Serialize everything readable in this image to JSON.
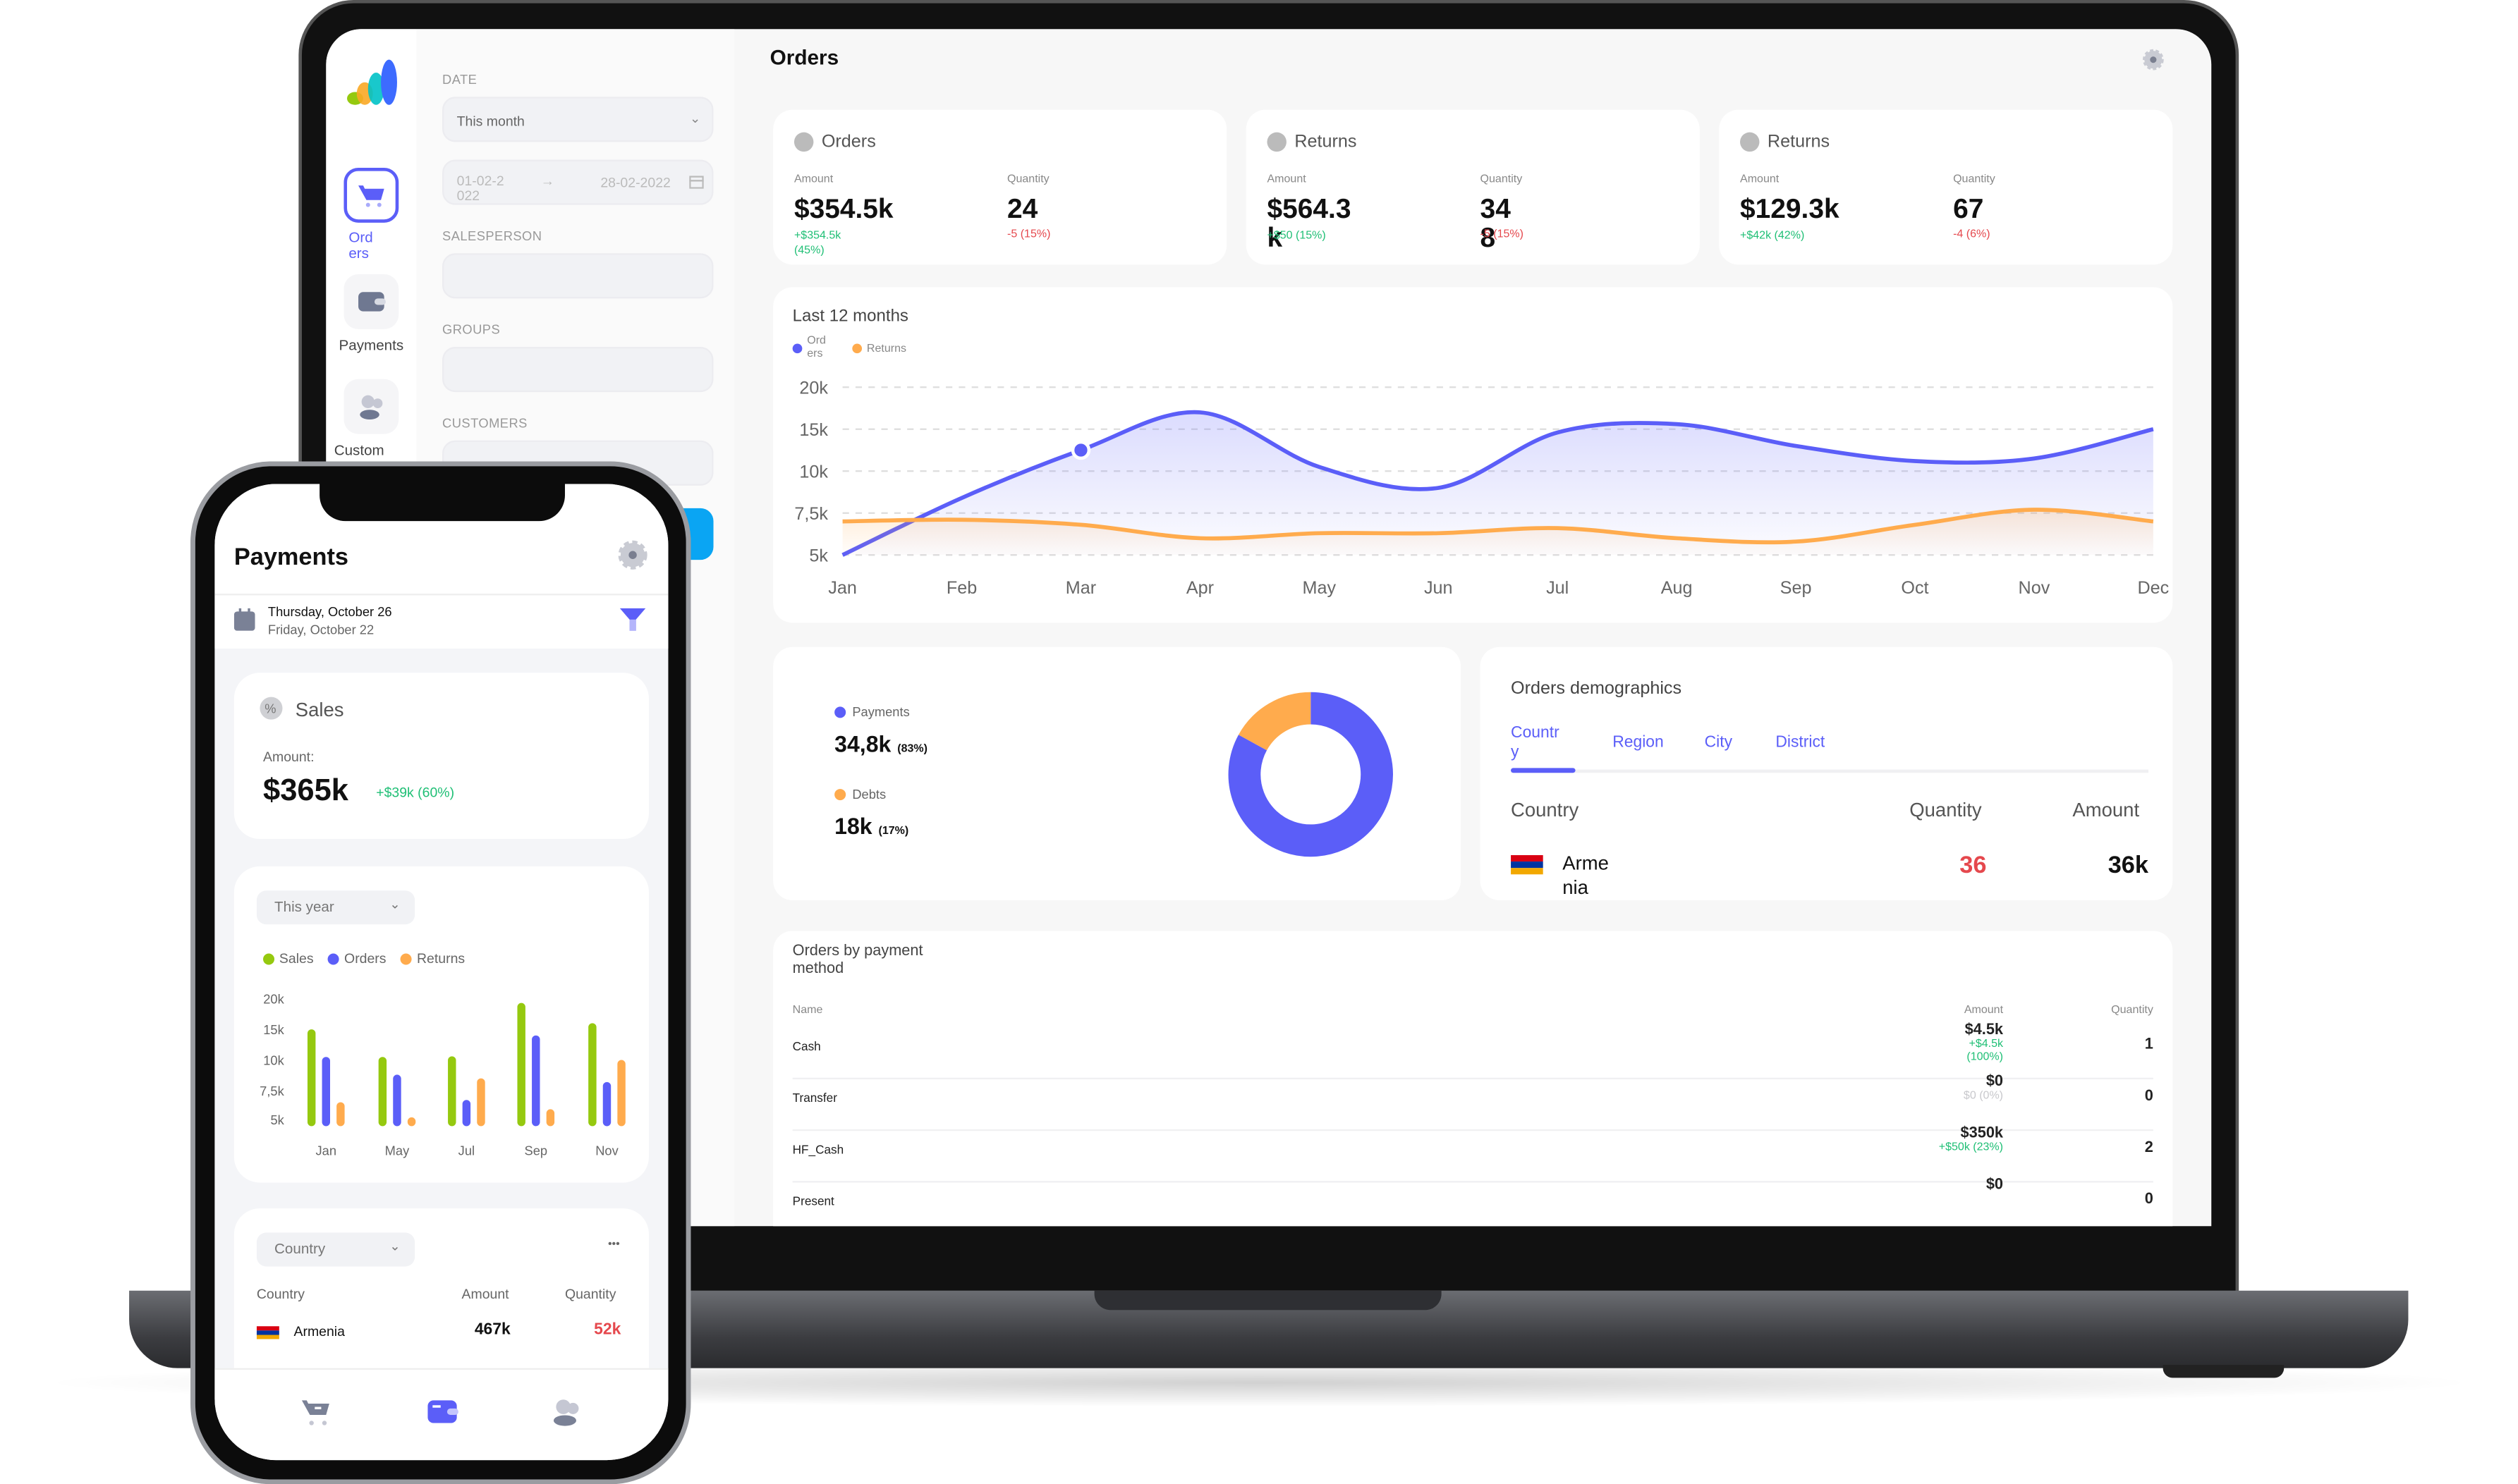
{
  "colors": {
    "accent": "#5b5ef8",
    "orders": "#5b5ef8",
    "returns": "#ffab4d",
    "sales": "#95c90f",
    "positive": "#1fbf75",
    "negative": "#e5484d"
  },
  "laptop": {
    "nav": {
      "items": [
        {
          "label": "Orders",
          "icon": "cart-icon",
          "active": true
        },
        {
          "label": "Payments",
          "icon": "wallet-icon"
        },
        {
          "label": "Custom",
          "icon": "users-icon"
        }
      ]
    },
    "filters": {
      "date_label": "DATE",
      "date_value": "This month",
      "date_from": "01-02-2022",
      "date_to": "28-02-2022",
      "date_arrow": "→",
      "salesperson_label": "SALESPERSON",
      "groups_label": "GROUPS",
      "customers_label": "CUSTOMERS"
    },
    "main": {
      "title": "Orders",
      "cards": [
        {
          "title": "Orders",
          "icon": "cart-icon",
          "amount_label": "Amount",
          "amount": "$354.5k",
          "amount_delta": "+$354.5k (45%)",
          "qty_label": "Quantity",
          "qty": "24",
          "qty_delta": "-5 (15%)"
        },
        {
          "title": "Returns",
          "icon": "return-icon",
          "amount_label": "Amount",
          "amount": "$564.3k",
          "amount_delta": "+$50 (15%)",
          "qty_label": "Quantity",
          "qty": "348",
          "qty_delta": "-5 (15%)"
        },
        {
          "title": "Returns",
          "icon": "compass-icon",
          "amount_label": "Amount",
          "amount": "$129.3k",
          "amount_delta": "+$42k (42%)",
          "qty_label": "Quantity",
          "qty": "67",
          "qty_delta": "-4 (6%)"
        }
      ],
      "payments": {
        "items": [
          {
            "label": "Payments",
            "value": "34,8k",
            "pct": "(83%)",
            "color": "#5b5ef8"
          },
          {
            "label": "Debts",
            "value": "18k",
            "pct": "(17%)",
            "color": "#ffab4d"
          }
        ]
      },
      "demographics": {
        "title": "Orders demographics",
        "tabs": [
          "Country",
          "Region",
          "City",
          "District"
        ],
        "active_tab": 0,
        "headers": [
          "Country",
          "Quantity",
          "Amount"
        ],
        "rows": [
          {
            "country": "Armenia",
            "quantity": "36",
            "amount": "36k"
          }
        ]
      },
      "payment_methods": {
        "title": "Orders by payment method",
        "headers": [
          "Name",
          "Amount",
          "Quantity"
        ],
        "rows": [
          {
            "name": "Cash",
            "amount": "$4.5k",
            "delta": "+$4.5k (100%)",
            "delta_type": "positive",
            "qty": "1"
          },
          {
            "name": "Transfer",
            "amount": "$0",
            "delta": "$0 (0%)",
            "delta_type": "neutral",
            "qty": "0"
          },
          {
            "name": "HF_Cash",
            "amount": "$350k",
            "delta": "+$50k (23%)",
            "delta_type": "positive",
            "qty": "2"
          },
          {
            "name": "Present",
            "amount": "$0",
            "delta": "",
            "delta_type": "neutral",
            "qty": "0"
          }
        ]
      }
    }
  },
  "phone": {
    "title": "Payments",
    "date_primary": "Thursday, October 26",
    "date_secondary": "Friday, October 22",
    "sales": {
      "title": "Sales",
      "amount_label": "Amount:",
      "amount": "$365k",
      "delta": "+$39k (60%)"
    },
    "period": "This year",
    "country_select": "Country",
    "more": "•••",
    "table": {
      "headers": [
        "Country",
        "Amount",
        "Quantity"
      ],
      "rows": [
        {
          "country": "Armenia",
          "amount": "467k",
          "quantity": "52k"
        }
      ]
    },
    "tabs": [
      {
        "icon": "cart-icon"
      },
      {
        "icon": "wallet-icon",
        "active": true
      },
      {
        "icon": "users-icon"
      }
    ]
  },
  "chart_data": [
    {
      "type": "line",
      "title": "Last 12 months",
      "categories": [
        "Jan",
        "Feb",
        "Mar",
        "Apr",
        "May",
        "Jun",
        "Jul",
        "Aug",
        "Sep",
        "Oct",
        "Nov",
        "Dec"
      ],
      "y_ticks": [
        "20k",
        "15k",
        "10k",
        "7,5k",
        "5k"
      ],
      "y_tick_values": [
        20000,
        15000,
        10000,
        7500,
        5000
      ],
      "grid": true,
      "legend": "top-left",
      "series": [
        {
          "name": "Orders",
          "color": "#5b5ef8",
          "values": [
            5000,
            8400,
            12500,
            17000,
            10500,
            9000,
            14600,
            15600,
            13000,
            11200,
            11500,
            15000
          ]
        },
        {
          "name": "Returns",
          "color": "#ffab4d",
          "values": [
            7000,
            7100,
            6800,
            6000,
            6300,
            6300,
            6600,
            6000,
            5800,
            6800,
            7700,
            7000
          ]
        }
      ],
      "highlight": {
        "category": "Mar",
        "series": "Orders"
      }
    },
    {
      "type": "pie",
      "series": [
        {
          "name": "Payments",
          "value": 83,
          "color": "#5b5ef8"
        },
        {
          "name": "Debts",
          "value": 17,
          "color": "#ffab4d"
        }
      ],
      "donut": true
    },
    {
      "type": "bar",
      "categories": [
        "Jan",
        "May",
        "Jul",
        "Sep",
        "Nov"
      ],
      "y_ticks": [
        "20k",
        "15k",
        "10k",
        "7,5k",
        "5k"
      ],
      "y_tick_values": [
        20000,
        15000,
        10000,
        7500,
        5000
      ],
      "legend": "top-left",
      "series": [
        {
          "name": "Sales",
          "color": "#95c90f",
          "values": [
            15000,
            10500,
            10600,
            19300,
            16000
          ]
        },
        {
          "name": "Orders",
          "color": "#5b5ef8",
          "values": [
            10500,
            8800,
            6700,
            14000,
            8200
          ]
        },
        {
          "name": "Returns",
          "color": "#ffab4d",
          "values": [
            6500,
            5200,
            8500,
            5900,
            10000
          ]
        }
      ]
    }
  ]
}
